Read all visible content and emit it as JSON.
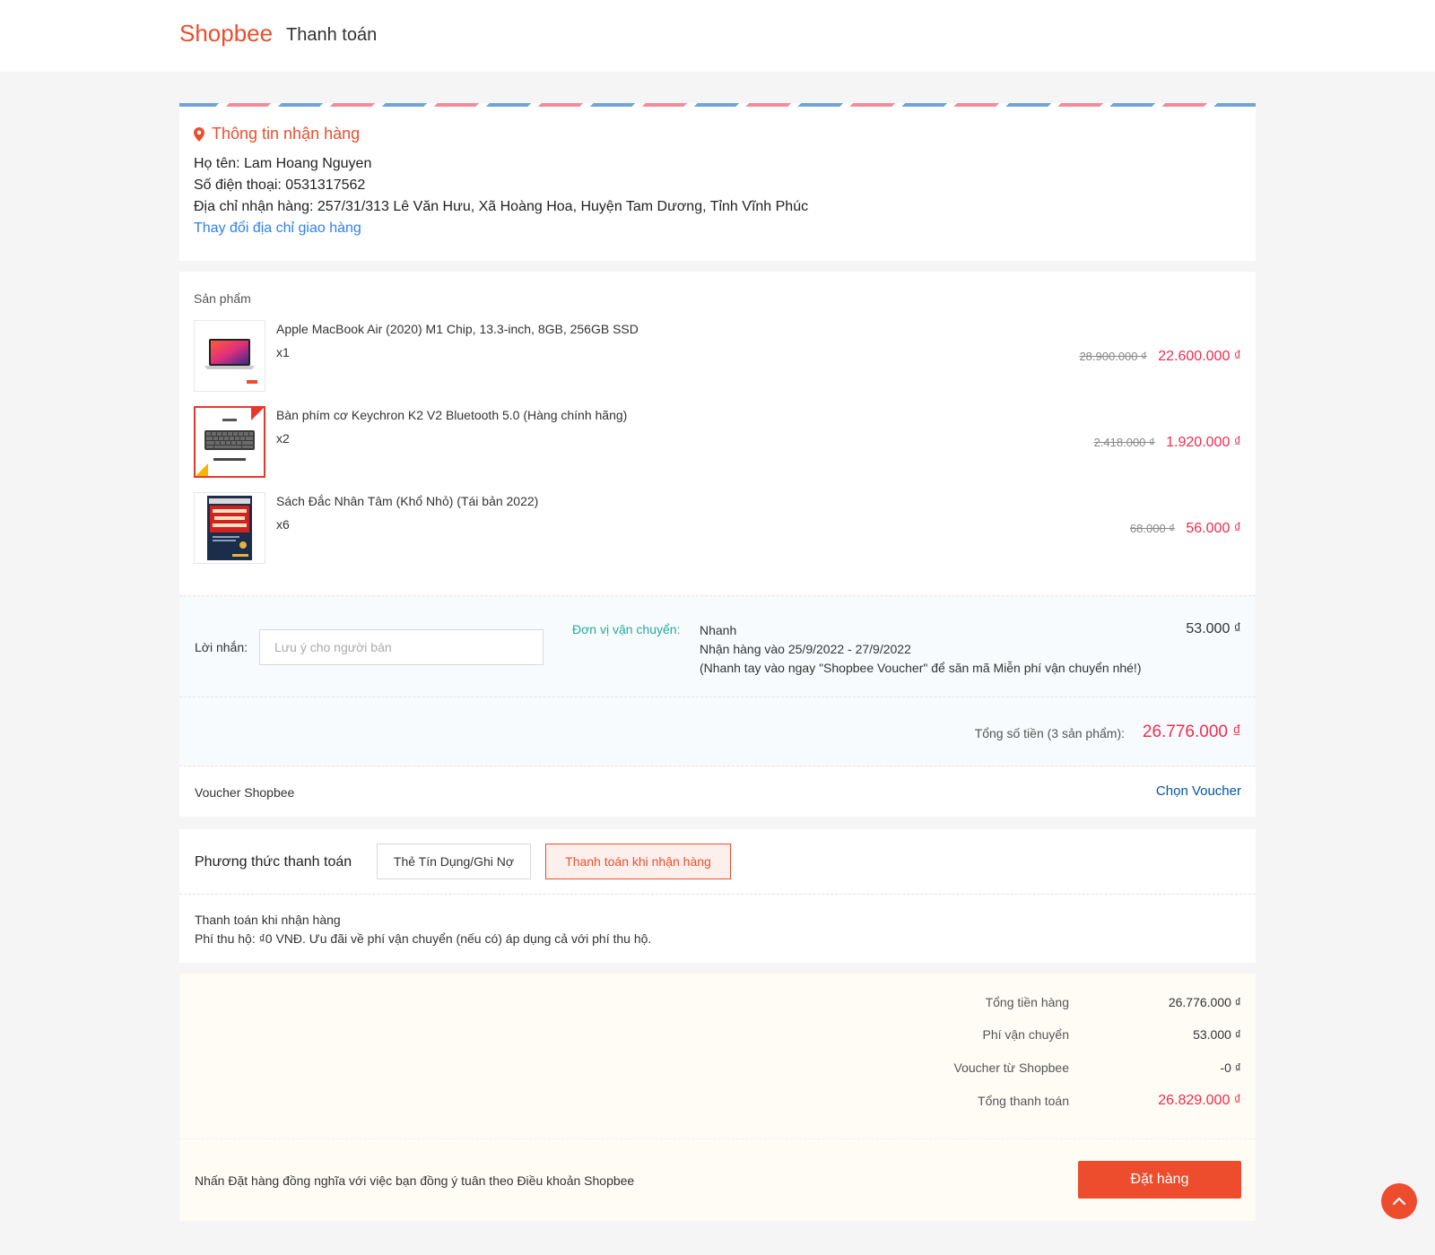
{
  "header": {
    "brand": "Shopbee",
    "title": "Thanh toán"
  },
  "colors": {
    "accent": "#ee4d2d",
    "price": "#ee2d4f",
    "link": "#2f80ed",
    "shipping_label": "#26aa99"
  },
  "address": {
    "title": "Thông tin nhận hàng",
    "name_line": "Họ tên: Lam Hoang Nguyen",
    "phone_line": "Số điện thoại: 0531317562",
    "address_line": "Địa chỉ nhận hàng: 257/31/313 Lê Văn Hưu, Xã Hoàng Hoa, Huyện Tam Dương, Tỉnh Vĩnh Phúc",
    "change_link": "Thay đổi địa chỉ giao hàng"
  },
  "products": {
    "heading": "Sản phẩm",
    "items": [
      {
        "name": "Apple MacBook Air (2020) M1 Chip, 13.3-inch, 8GB, 256GB SSD",
        "qty": "x1",
        "old_price": "28.900.000 ₫",
        "price": "22.600.000 ₫"
      },
      {
        "name": "Bàn phím cơ Keychron K2 V2 Bluetooth 5.0 (Hàng chính hãng)",
        "qty": "x2",
        "old_price": "2.418.000 ₫",
        "price": "1.920.000 ₫"
      },
      {
        "name": "Sách Đắc Nhân Tâm (Khổ Nhỏ) (Tái bản 2022)",
        "qty": "x6",
        "old_price": "68.000 ₫",
        "price": "56.000 ₫"
      }
    ]
  },
  "message": {
    "label": "Lời nhắn:",
    "placeholder": "Lưu ý cho người bán",
    "value": ""
  },
  "shipping": {
    "label": "Đơn vị vận chuyển:",
    "method": "Nhanh",
    "eta": "Nhận hàng vào 25/9/2022 - 27/9/2022",
    "note": "(Nhanh tay vào ngay \"Shopbee Voucher\" để săn mã Miễn phí vận chuyển nhé!)",
    "fee": "53.000 ₫"
  },
  "subtotal": {
    "label": "Tổng số tiền (3 sản phẩm):",
    "value": "26.776.000 ₫"
  },
  "voucher": {
    "label": "Voucher Shopbee",
    "link": "Chọn Voucher"
  },
  "payment": {
    "title": "Phương thức thanh toán",
    "options": [
      "Thẻ Tín Dụng/Ghi Nợ",
      "Thanh toán khi nhận hàng"
    ],
    "selected": "Thanh toán khi nhận hàng",
    "desc_title": "Thanh toán khi nhận hàng",
    "desc": "Phí thu hộ: ₫0 VNĐ. Ưu đãi về phí vận chuyển (nếu có) áp dụng cả với phí thu hộ."
  },
  "summary": {
    "rows": [
      {
        "label": "Tổng tiền hàng",
        "value": "26.776.000 ₫"
      },
      {
        "label": "Phí vận chuyển",
        "value": "53.000 ₫"
      },
      {
        "label": "Voucher từ Shopbee",
        "value": "-0 ₫"
      },
      {
        "label": "Tổng thanh toán",
        "value": "26.829.000 ₫"
      }
    ]
  },
  "footer": {
    "terms": "Nhấn Đặt hàng đồng nghĩa với việc bạn đồng ý tuân theo Điều khoản Shopbee",
    "order_button": "Đặt hàng"
  }
}
